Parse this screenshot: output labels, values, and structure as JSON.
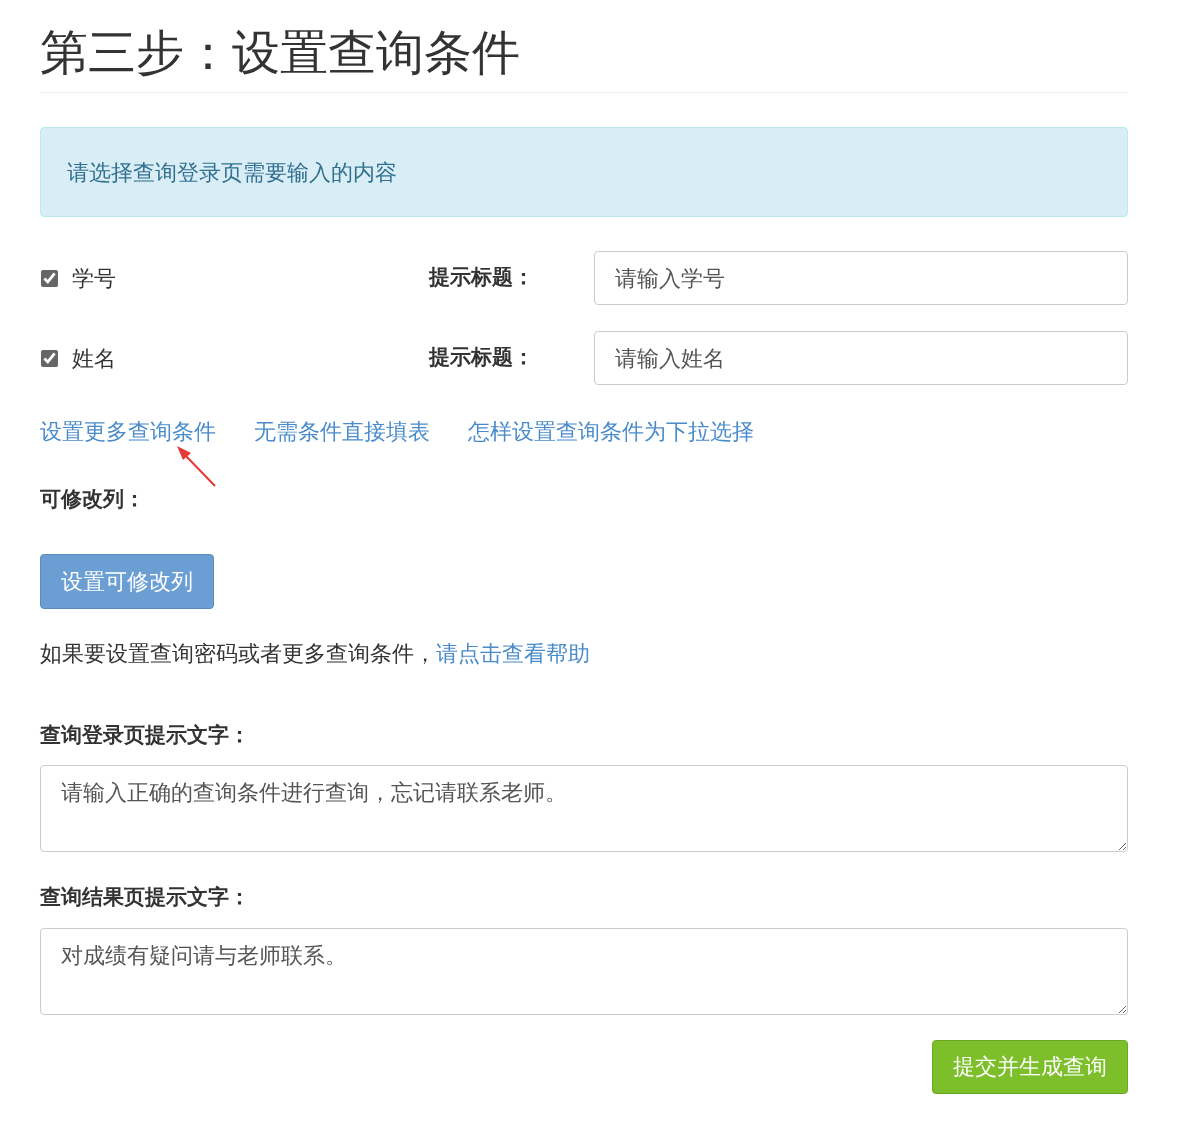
{
  "title": "第三步：设置查询条件",
  "alert": "请选择查询登录页需要输入的内容",
  "conditions": [
    {
      "label": "学号",
      "checked": true,
      "hint_label": "提示标题：",
      "placeholder": "请输入学号"
    },
    {
      "label": "姓名",
      "checked": true,
      "hint_label": "提示标题：",
      "placeholder": "请输入姓名"
    }
  ],
  "links": [
    "设置更多查询条件",
    "无需条件直接填表",
    "怎样设置查询条件为下拉选择"
  ],
  "editable_label": "可修改列：",
  "editable_button": "设置可修改列",
  "help_text": "如果要设置查询密码或者更多查询条件，",
  "help_link": "请点击查看帮助",
  "login_tip_label": "查询登录页提示文字：",
  "login_tip_value": "请输入正确的查询条件进行查询，忘记请联系老师。",
  "result_tip_label": "查询结果页提示文字：",
  "result_tip_value": "对成绩有疑问请与老师联系。",
  "submit_button": "提交并生成查询"
}
